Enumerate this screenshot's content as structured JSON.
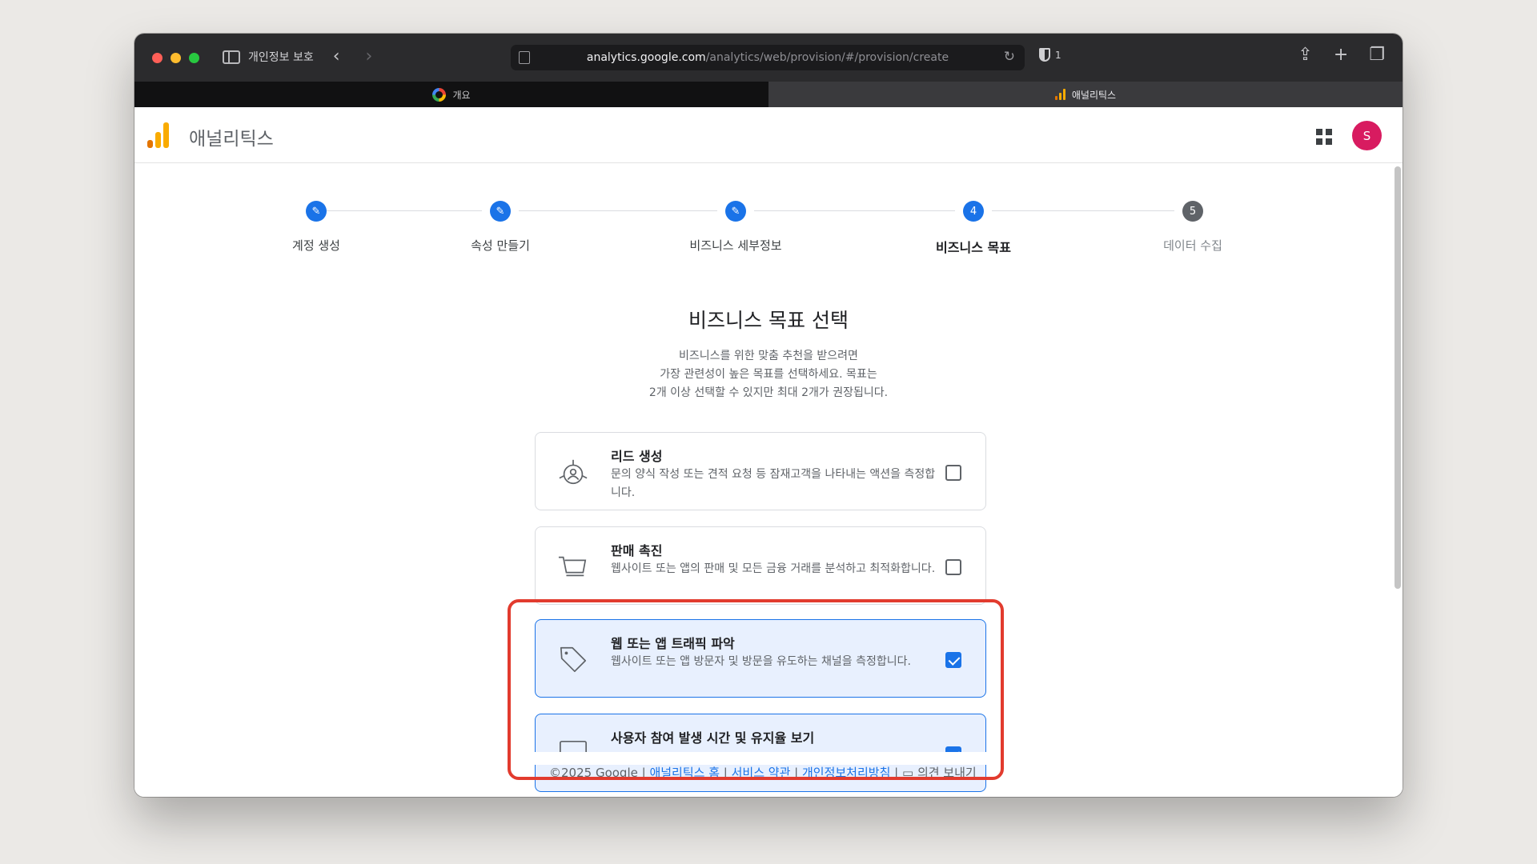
{
  "browser": {
    "privacy_label": "개인정보 보호",
    "url_host": "analytics.google.com",
    "url_path": "/analytics/web/provision/#/provision/create",
    "shield_count": "1",
    "tabs": [
      {
        "label": "개요",
        "active": false
      },
      {
        "label": "애널리틱스",
        "active": true
      }
    ]
  },
  "app": {
    "title": "애널리틱스",
    "avatar_letter": "S",
    "brand_colors": {
      "orange": "#f9ab00",
      "dark_orange": "#e37400"
    }
  },
  "stepper": {
    "steps": [
      {
        "label": "계정 생성",
        "state": "done",
        "marker": "✎"
      },
      {
        "label": "속성 만들기",
        "state": "done",
        "marker": "✎"
      },
      {
        "label": "비즈니스 세부정보",
        "state": "done",
        "marker": "✎"
      },
      {
        "label": "비즈니스 목표",
        "state": "current",
        "marker": "4"
      },
      {
        "label": "데이터 수집",
        "state": "todo",
        "marker": "5"
      }
    ]
  },
  "page": {
    "title": "비즈니스 목표 선택",
    "description_lines": [
      "비즈니스를 위한 맞춤 추천을 받으려면",
      "가장 관련성이 높은 목표를 선택하세요. 목표는",
      "2개 이상 선택할 수 있지만 최대 2개가 권장됩니다."
    ]
  },
  "goals": [
    {
      "title": "리드 생성",
      "description": "문의 양식 작성 또는 견적 요청 등 잠재고객을 나타내는 액션을 측정합니다.",
      "checked": false,
      "icon": "lead-target-icon"
    },
    {
      "title": "판매 촉진",
      "description": "웹사이트 또는 앱의 판매 및 모든 금융 거래를 분석하고 최적화합니다.",
      "checked": false,
      "icon": "shopping-cart-icon"
    },
    {
      "title": "웹 또는 앱 트래픽 파악",
      "description": "웹사이트 또는 앱 방문자 및 방문을 유도하는 채널을 측정합니다.",
      "checked": true,
      "icon": "tag-icon"
    },
    {
      "title": "사용자 참여 발생 시간 및 유지율 보기",
      "description": "",
      "checked": true,
      "icon": "screen-icon"
    }
  ],
  "footer": {
    "copyright": "©2025 Google | ",
    "links": [
      "애널리틱스 홈",
      "서비스 약관",
      "개인정보처리방침"
    ],
    "feedback": "의견 보내기"
  },
  "colors": {
    "accent": "#1a73e8",
    "highlight": "#e23b2e"
  }
}
